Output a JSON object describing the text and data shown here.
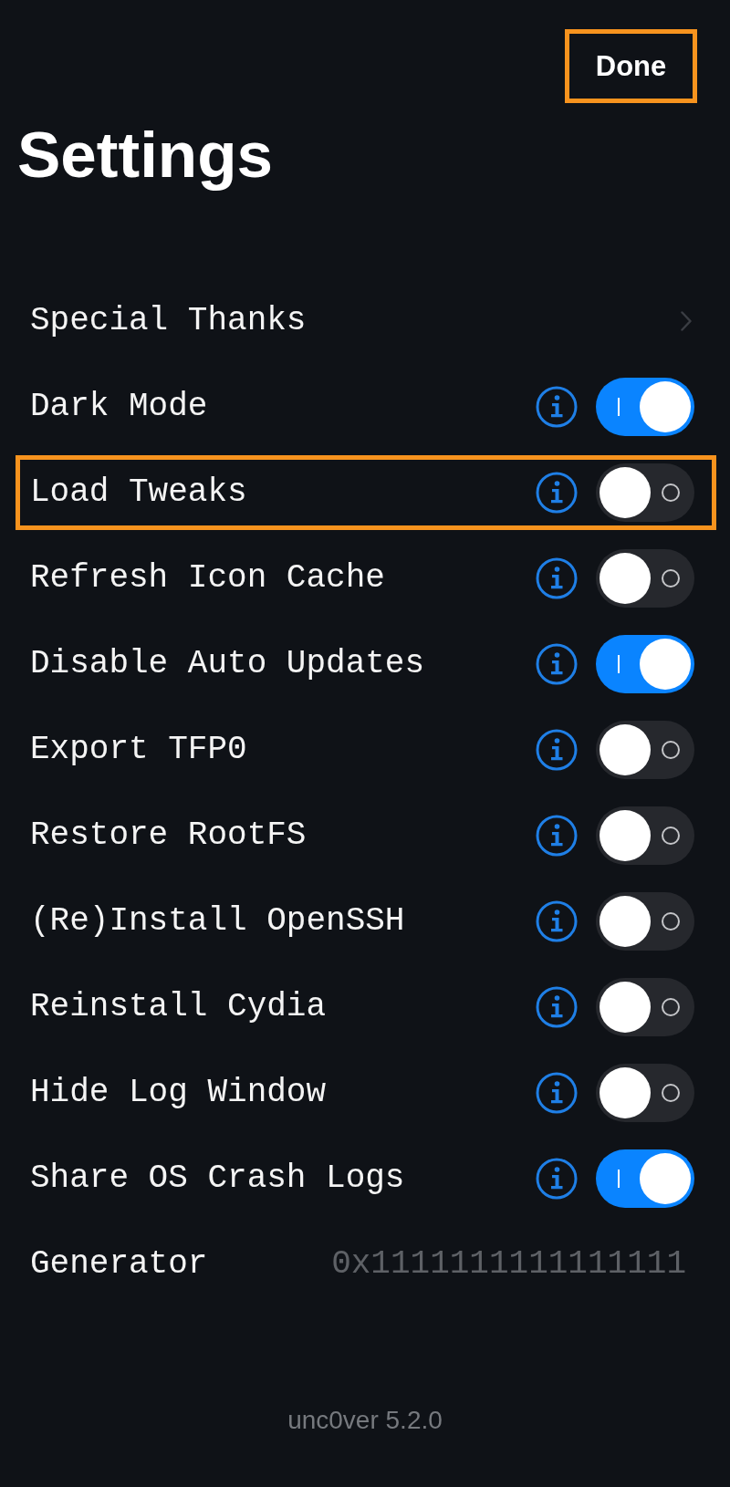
{
  "done_button": {
    "label": "Done",
    "highlighted": true
  },
  "title": "Settings",
  "rows": [
    {
      "kind": "link",
      "label": "Special Thanks",
      "highlighted": false
    },
    {
      "kind": "toggle",
      "label": "Dark Mode",
      "on": true,
      "highlighted": false
    },
    {
      "kind": "toggle",
      "label": "Load Tweaks",
      "on": false,
      "highlighted": true
    },
    {
      "kind": "toggle",
      "label": "Refresh Icon Cache",
      "on": false,
      "highlighted": false
    },
    {
      "kind": "toggle",
      "label": "Disable Auto Updates",
      "on": true,
      "highlighted": false
    },
    {
      "kind": "toggle",
      "label": "Export TFP0",
      "on": false,
      "highlighted": false
    },
    {
      "kind": "toggle",
      "label": "Restore RootFS",
      "on": false,
      "highlighted": false
    },
    {
      "kind": "toggle",
      "label": "(Re)Install OpenSSH",
      "on": false,
      "highlighted": false
    },
    {
      "kind": "toggle",
      "label": "Reinstall Cydia",
      "on": false,
      "highlighted": false
    },
    {
      "kind": "toggle",
      "label": "Hide Log Window",
      "on": false,
      "highlighted": false
    },
    {
      "kind": "toggle",
      "label": "Share OS Crash Logs",
      "on": true,
      "highlighted": false
    },
    {
      "kind": "value",
      "label": "Generator",
      "value": "0x1111111111111111",
      "highlighted": false
    }
  ],
  "footer": "unc0ver 5.2.0"
}
